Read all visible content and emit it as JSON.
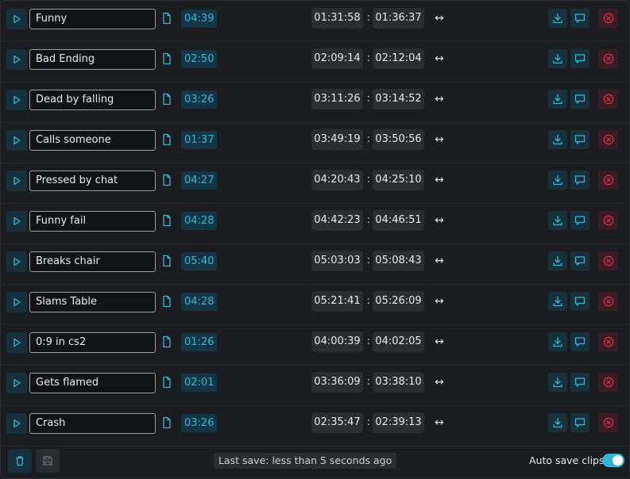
{
  "colors": {
    "accent": "#35b4d9",
    "danger": "#d0304a",
    "background": "#1c1d20"
  },
  "clips": [
    {
      "name": "Funny",
      "duration": "04:39",
      "start": "01:31:58",
      "end": "01:36:37"
    },
    {
      "name": "Bad Ending",
      "duration": "02:50",
      "start": "02:09:14",
      "end": "02:12:04"
    },
    {
      "name": "Dead by falling",
      "duration": "03:26",
      "start": "03:11:26",
      "end": "03:14:52"
    },
    {
      "name": "Calls someone",
      "duration": "01:37",
      "start": "03:49:19",
      "end": "03:50:56"
    },
    {
      "name": "Pressed by chat",
      "duration": "04:27",
      "start": "04:20:43",
      "end": "04:25:10"
    },
    {
      "name": "Funny fail",
      "duration": "04:28",
      "start": "04:42:23",
      "end": "04:46:51"
    },
    {
      "name": "Breaks chair",
      "duration": "05:40",
      "start": "05:03:03",
      "end": "05:08:43"
    },
    {
      "name": "Slams Table",
      "duration": "04:28",
      "start": "05:21:41",
      "end": "05:26:09"
    },
    {
      "name": "0:9 in cs2",
      "duration": "01:26",
      "start": "04:00:39",
      "end": "04:02:05"
    },
    {
      "name": "Gets flamed",
      "duration": "02:01",
      "start": "03:36:09",
      "end": "03:38:10"
    },
    {
      "name": "Crash",
      "duration": "03:26",
      "start": "02:35:47",
      "end": "02:39:13"
    }
  ],
  "separator": ":",
  "swap_symbol": "↔",
  "icons": {
    "play": "play-icon",
    "file": "file-icon",
    "download": "download-icon",
    "comment": "comment-icon",
    "remove": "close-circle-icon",
    "trash": "trash-icon",
    "save": "save-icon"
  },
  "footer": {
    "last_save": "Last save: less than 5 seconds ago",
    "auto_save_label": "Auto save clips",
    "auto_save_enabled": true
  }
}
